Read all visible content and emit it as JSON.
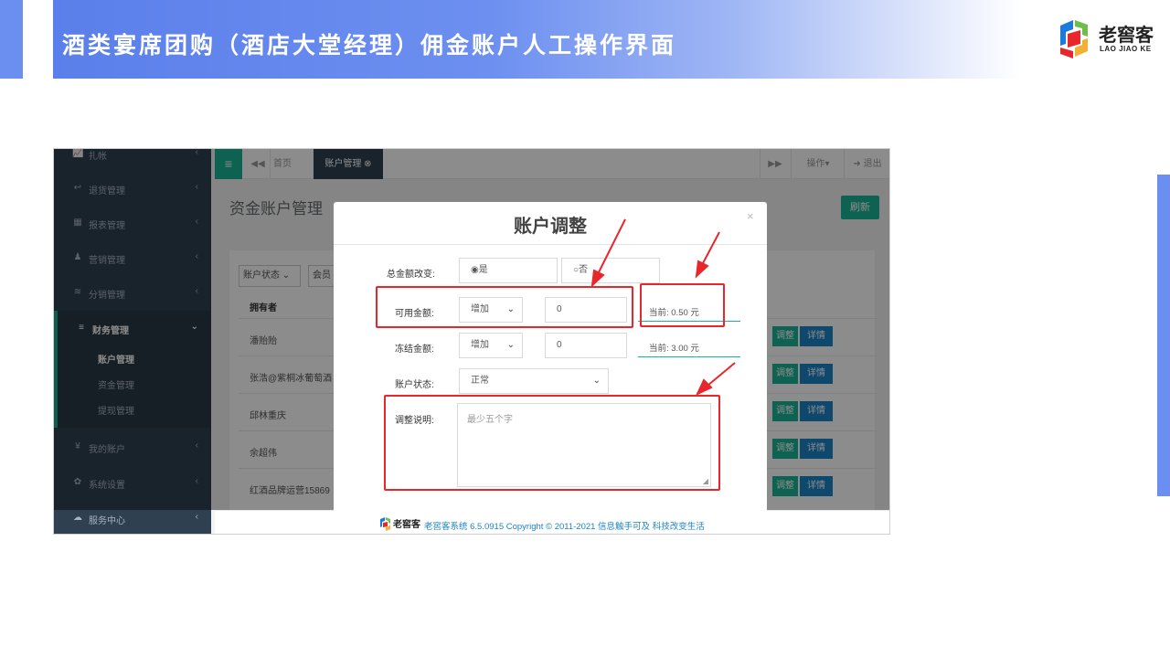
{
  "slide": {
    "title": "酒类宴席团购（酒店大堂经理）佣金账户人工操作界面",
    "logo_cn": "老窖客",
    "logo_en": "LAO JIAO KE"
  },
  "colors": {
    "accent_blue": "#6b8ff0",
    "sidebar": "#2f4050",
    "green": "#1ab394",
    "blue_btn": "#1c84c6",
    "annotation_red": "#e8262b"
  },
  "sidebar": {
    "items": [
      {
        "icon": "📈",
        "label": "扎帐",
        "chevron": "‹"
      },
      {
        "icon": "↩",
        "label": "退货管理",
        "chevron": "‹"
      },
      {
        "icon": "▦",
        "label": "报表管理",
        "chevron": "‹"
      },
      {
        "icon": "♟",
        "label": "营销管理",
        "chevron": "‹"
      },
      {
        "icon": "≋",
        "label": "分销管理",
        "chevron": "‹"
      },
      {
        "icon": "≡",
        "label": "财务管理",
        "chevron": "⌄"
      },
      {
        "icon": "¥",
        "label": "我的账户",
        "chevron": "‹"
      },
      {
        "icon": "✿",
        "label": "系统设置",
        "chevron": "‹"
      },
      {
        "icon": "☁",
        "label": "服务中心",
        "chevron": "‹"
      }
    ],
    "sub_items": [
      "账户管理",
      "资金管理",
      "提现管理"
    ]
  },
  "topbar": {
    "menu": "≡",
    "back": "◀◀",
    "home": "首页",
    "active_tab": "账户管理 ⊗",
    "forward": "▶▶",
    "ops": "操作▾",
    "logout": "➜ 退出"
  },
  "page": {
    "title": "资金账户管理",
    "refresh": "刷新",
    "filter_status": "账户状态 ⌄",
    "filter_member": "会员",
    "col_owner": "拥有者",
    "rows": [
      {
        "name": "潘贻贻",
        "adjust": "调整",
        "detail": "详情"
      },
      {
        "name": "张浩@紫桐冰葡萄酒",
        "adjust": "调整",
        "detail": "详情"
      },
      {
        "name": "邱林重庆",
        "adjust": "调整",
        "detail": "详情"
      },
      {
        "name": "余超伟",
        "adjust": "调整",
        "detail": "详情"
      },
      {
        "name": "红酒品牌运营15869",
        "adjust": "调整",
        "detail": "详情"
      }
    ]
  },
  "modal": {
    "title": "账户调整",
    "close": "×",
    "total_change_label": "总金额改变:",
    "radio_yes": "◉是",
    "radio_no": "○否",
    "available_label": "可用金额:",
    "available_op": "增加",
    "available_value": "0",
    "available_current": "当前: 0.50 元",
    "frozen_label": "冻结金额:",
    "frozen_op": "增加",
    "frozen_value": "0",
    "frozen_current": "当前: 3.00 元",
    "status_label": "账户状态:",
    "status_value": "正常",
    "note_label": "调整说明:",
    "note_placeholder": "最少五个字"
  },
  "footer": {
    "logo_text": "老窖客",
    "text": "老窖客系统 6.5.0915 Copyright © 2011-2021 信息触手可及 科技改变生活"
  }
}
